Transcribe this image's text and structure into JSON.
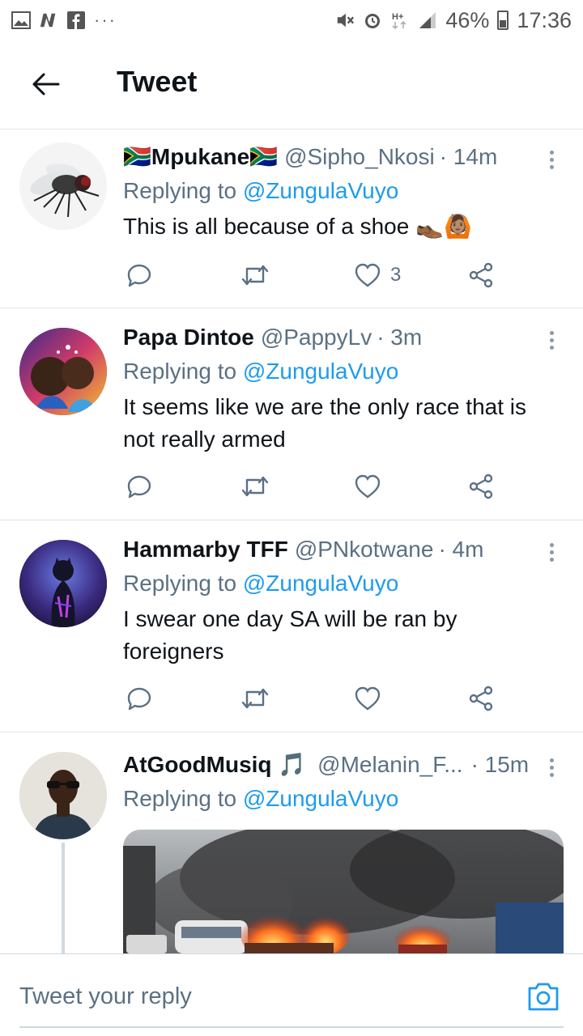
{
  "status_bar": {
    "left_icons": [
      "gallery-icon",
      "n-app-icon",
      "facebook-icon"
    ],
    "more": "···",
    "right_icons": [
      "mute-icon",
      "alarm-icon",
      "hplus-icon",
      "signal-icon"
    ],
    "battery": "46%",
    "time": "17:36"
  },
  "header": {
    "title": "Tweet",
    "back_icon": "arrow-left-icon"
  },
  "tweets": [
    {
      "name": "🇿🇦Mpukane🇿🇦",
      "handle": "@Sipho_Nkosi",
      "time": "· 14m",
      "replying_prefix": "Replying to",
      "replying_to": "@ZungulaVuyo",
      "text": "This is all because of a shoe 👞🙆🏽",
      "likes": "3",
      "avatar_icon": "fly-avatar"
    },
    {
      "name": "Papa Dintoe",
      "handle": "@PappyLv",
      "time": "· 3m",
      "replying_prefix": "Replying to",
      "replying_to": "@ZungulaVuyo",
      "text": "It seems like we are the only race that is not really armed",
      "likes": "",
      "avatar_icon": "illustration-avatar"
    },
    {
      "name": "Hammarby TFF",
      "handle": "@PNkotwane",
      "time": "· 4m",
      "replying_prefix": "Replying to",
      "replying_to": "@ZungulaVuyo",
      "text": "I swear one day SA will be ran by foreigners",
      "likes": "",
      "avatar_icon": "panther-avatar"
    },
    {
      "name": "AtGoodMusiq 🎵",
      "handle": "@Melanin_F...",
      "time": "· 15m",
      "replying_prefix": "Replying to",
      "replying_to": "@ZungulaVuyo",
      "media": "burning-vehicles-photo",
      "avatar_icon": "man-sunglasses-avatar"
    }
  ],
  "reply_bar": {
    "placeholder": "Tweet your reply",
    "camera_icon": "camera-icon"
  },
  "colors": {
    "link": "#1d9bf0",
    "secondary_text": "#5b7083",
    "divider": "#e1e4e8"
  }
}
